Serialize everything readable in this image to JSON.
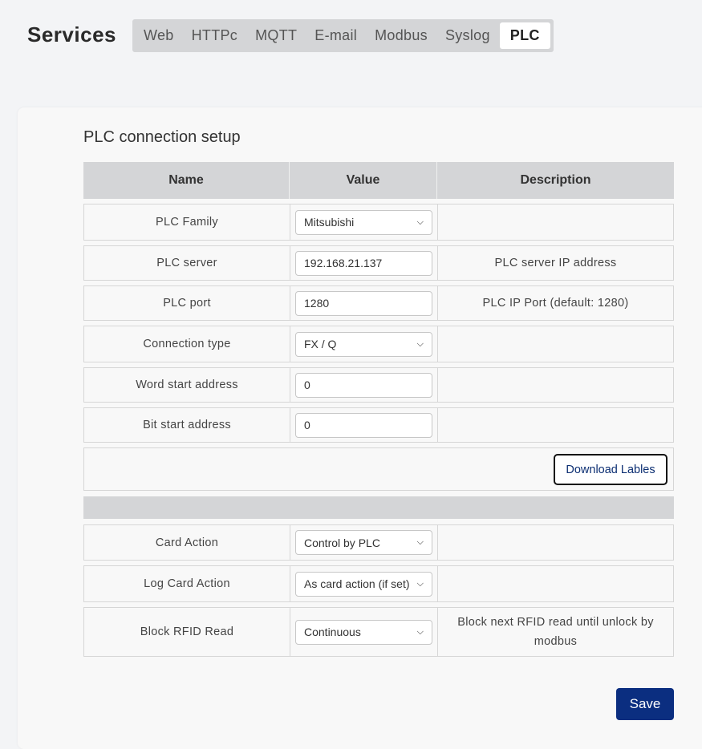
{
  "header": {
    "title": "Services",
    "tabs": [
      "Web",
      "HTTPc",
      "MQTT",
      "E-mail",
      "Modbus",
      "Syslog",
      "PLC"
    ],
    "active_tab": "PLC"
  },
  "section": {
    "title": "PLC connection setup",
    "columns": [
      "Name",
      "Value",
      "Description"
    ]
  },
  "rows": {
    "plc_family": {
      "name": "PLC Family",
      "value": "Mitsubishi",
      "description": ""
    },
    "plc_server": {
      "name": "PLC server",
      "value": "192.168.21.137",
      "description": "PLC server IP address"
    },
    "plc_port": {
      "name": "PLC port",
      "value": "1280",
      "description": "PLC IP Port (default: 1280)"
    },
    "connection_type": {
      "name": "Connection type",
      "value": "FX / Q",
      "description": ""
    },
    "word_start": {
      "name": "Word start address",
      "value": "0",
      "description": ""
    },
    "bit_start": {
      "name": "Bit start address",
      "value": "0",
      "description": ""
    },
    "card_action": {
      "name": "Card Action",
      "value": "Control by PLC",
      "description": ""
    },
    "log_card_action": {
      "name": "Log Card Action",
      "value": "As card action (if set)",
      "description": ""
    },
    "block_rfid": {
      "name": "Block RFID Read",
      "value": "Continuous",
      "description": "Block next RFID read until unlock by modbus"
    }
  },
  "buttons": {
    "download": "Download Lables",
    "save": "Save"
  },
  "colors": {
    "accent": "#0b2e80",
    "header_bg": "#d4d5d7"
  }
}
